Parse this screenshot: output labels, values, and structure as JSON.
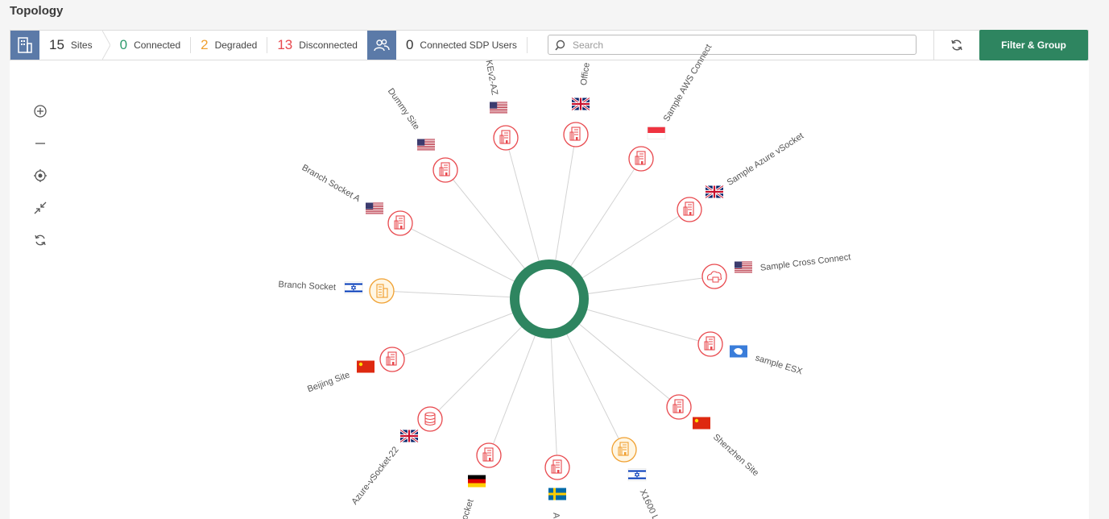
{
  "page": {
    "title": "Topology"
  },
  "toolbar": {
    "sites_count": "15",
    "sites_label": "Sites",
    "connected_count": "0",
    "connected_label": "Connected",
    "degraded_count": "2",
    "degraded_label": "Degraded",
    "disconnected_count": "13",
    "disconnected_label": "Disconnected",
    "sdp_count": "0",
    "sdp_label": "Connected SDP Users",
    "search_placeholder": "Search",
    "filter_label": "Filter & Group"
  },
  "colors": {
    "connected": "#2e9b6d",
    "degraded": "#f0a030",
    "disconnected": "#e8484d",
    "hub": "#2e8560",
    "brand": "#5b7aa8"
  },
  "sites": [
    {
      "name": "Sample AWS Connect",
      "flag": "SG",
      "status": "disconnected",
      "icon": "building"
    },
    {
      "name": "Sample Azure vSocket",
      "flag": "GB",
      "status": "disconnected",
      "icon": "building"
    },
    {
      "name": "Sample Cross Connect",
      "flag": "US",
      "status": "disconnected",
      "icon": "cloud"
    },
    {
      "name": "sample ESX",
      "flag": "AQ",
      "status": "disconnected",
      "icon": "building"
    },
    {
      "name": "Shenzhen Site",
      "flag": "CN",
      "status": "disconnected",
      "icon": "building"
    },
    {
      "name": "X1600 L",
      "flag": "IL",
      "status": "degraded",
      "icon": "building"
    },
    {
      "name": "A",
      "flag": "SE",
      "status": "disconnected",
      "icon": "building"
    },
    {
      "name": "ocket",
      "flag": "DE",
      "status": "disconnected",
      "icon": "building"
    },
    {
      "name": "Azure-vSocket-22",
      "flag": "GB",
      "status": "disconnected",
      "icon": "database"
    },
    {
      "name": "Beijing Site",
      "flag": "CN",
      "status": "disconnected",
      "icon": "building"
    },
    {
      "name": "Branch Socket",
      "flag": "IL",
      "status": "degraded",
      "icon": "office"
    },
    {
      "name": "Branch Socket A",
      "flag": "US",
      "status": "disconnected",
      "icon": "building"
    },
    {
      "name": "Dummy Site",
      "flag": "US",
      "status": "disconnected",
      "icon": "building"
    },
    {
      "name": "KEv2-AZ",
      "flag": "US",
      "status": "disconnected",
      "icon": "building"
    },
    {
      "name": "Office",
      "flag": "GB",
      "status": "disconnected",
      "icon": "building"
    }
  ]
}
